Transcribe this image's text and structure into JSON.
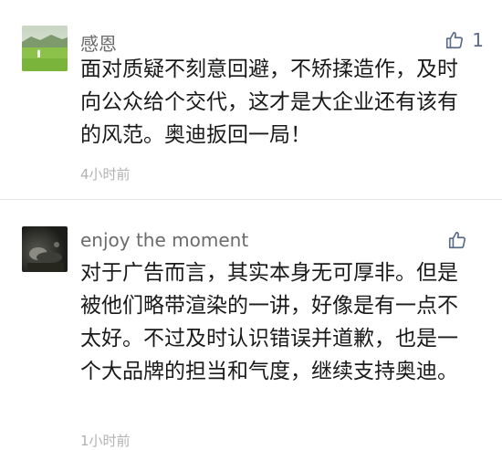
{
  "comments": [
    {
      "username": "感恩",
      "text": "面对质疑不刻意回避，不矫揉造作，及时向公众给个交代，这才是大企业还有该有的风范。奥迪扳回一局！",
      "time": "4小时前",
      "likes": "1",
      "avatar_icon": "landscape-avatar-icon"
    },
    {
      "username": "enjoy the moment",
      "text": "对于广告而言，其实本身无可厚非。但是被他们略带渲染的一讲，好像是有一点不太好。不过及时认识错误并道歉，也是一个大品牌的担当和气度，继续支持奥迪。",
      "time": "1小时前",
      "likes": "",
      "avatar_icon": "dark-photo-avatar-icon"
    }
  ],
  "colors": {
    "username": "#6b6b6b",
    "text": "#1a1a1a",
    "time": "#b2b2b2",
    "like_icon": "#5b6c8a",
    "divider": "#e6e6e6"
  }
}
